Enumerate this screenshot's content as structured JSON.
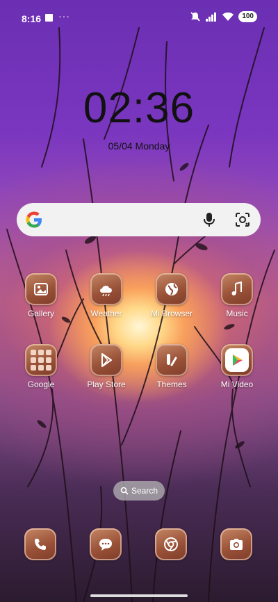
{
  "status_bar": {
    "time": "8:16",
    "overflow": "···",
    "battery": "100",
    "icons": [
      "mute-icon",
      "signal-icon",
      "wifi-icon"
    ]
  },
  "lockclock": {
    "time": "02:36",
    "date": "05/04 Monday"
  },
  "search_widget": {
    "logo": "google-logo",
    "icons": [
      "mic-icon",
      "lens-icon"
    ]
  },
  "apps": [
    {
      "label": "Gallery",
      "icon": "gallery-icon"
    },
    {
      "label": "Weather",
      "icon": "weather-icon"
    },
    {
      "label": "Mi Browser",
      "icon": "browser-icon"
    },
    {
      "label": "Music",
      "icon": "music-icon"
    },
    {
      "label": "Google",
      "icon": "folder-icon"
    },
    {
      "label": "Play Store",
      "icon": "play-store-icon"
    },
    {
      "label": "Themes",
      "icon": "themes-icon"
    },
    {
      "label": "Mi Video",
      "icon": "video-icon"
    }
  ],
  "search_pill": {
    "label": "Search"
  },
  "dock": [
    "phone-icon",
    "messages-icon",
    "chrome-icon",
    "camera-icon"
  ],
  "colors": {
    "accent_tile": "#9a5238",
    "search_bg": "#f2f2f2"
  }
}
